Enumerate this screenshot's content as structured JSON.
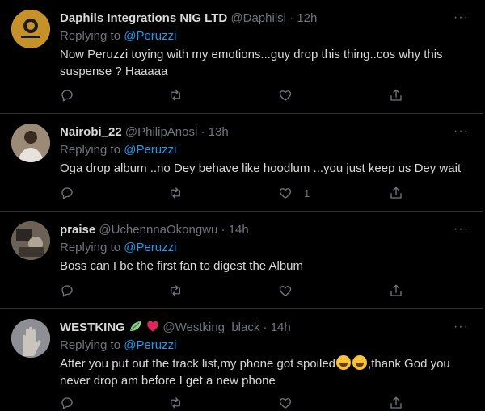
{
  "tweets": [
    {
      "name": "Daphils Integrations NIG LTD",
      "handle": "@Daphilsl",
      "dot": "·",
      "time": "12h",
      "replying_prefix": "Replying to",
      "replying_to": "@Peruzzi",
      "text_line1": "Now Peruzzi toying with my emotions...guy drop this thing..cos why this",
      "text_line2": "suspense ? Haaaaa",
      "like_count": "",
      "avatar_color": "#c7912a"
    },
    {
      "name": "Nairobi_22",
      "handle": "@PhilipAnosi",
      "dot": "·",
      "time": "13h",
      "replying_prefix": "Replying to",
      "replying_to": "@Peruzzi",
      "text_line1": "Oga drop album ..no Dey behave like hoodlum ...you just keep us Dey wait",
      "like_count": "1",
      "avatar_color": "#8a7b6a"
    },
    {
      "name": "praise",
      "handle": "@UchennnaOkongwu",
      "dot": "·",
      "time": "14h",
      "replying_prefix": "Replying to",
      "replying_to": "@Peruzzi",
      "text_line1": "Boss can I be the first fan to digest the Album",
      "like_count": "",
      "avatar_color": "#5a5046"
    },
    {
      "name": "WESTKING",
      "handle": "@Westking_black",
      "dot": "·",
      "time": "14h",
      "replying_prefix": "Replying to",
      "replying_to": "@Peruzzi",
      "text_line1_a": "After you put out the track list,my phone got spoiled",
      "text_line1_b": ",thank God you",
      "text_line2": "never drop am before I get a new phone",
      "like_count": "",
      "avatar_color": "#8d8f94"
    }
  ],
  "more_label": "···",
  "colors": {
    "background": "#000000",
    "text": "#d9d9d9",
    "muted": "#6e767d",
    "accent": "#1d9bf0",
    "divider": "#2f3336",
    "heart_red": "#e0245e"
  },
  "icons": [
    "reply-icon",
    "retweet-icon",
    "like-icon",
    "share-icon",
    "more-icon",
    "leaf-icon",
    "heart-emoji-icon",
    "laughing-emoji-icon",
    "smiling-emoji-icon"
  ]
}
